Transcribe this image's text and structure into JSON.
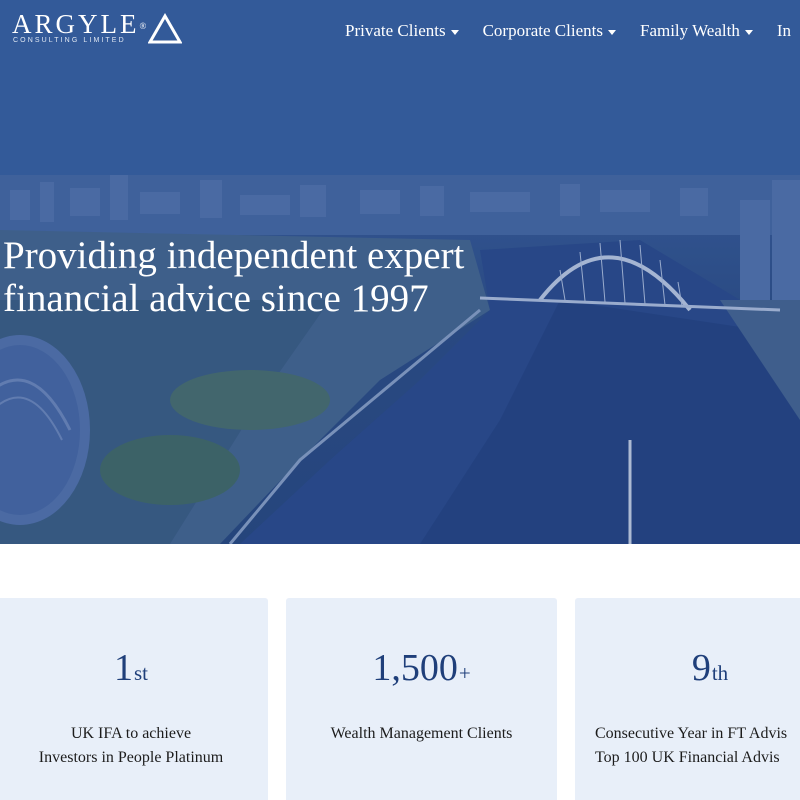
{
  "brand": {
    "name": "ARGYLE",
    "registered": "®",
    "subtitle": "CONSULTING LIMITED",
    "mark_icon": "triangle-icon"
  },
  "nav": {
    "items": [
      {
        "label": "Private Clients",
        "has_dropdown": true
      },
      {
        "label": "Corporate Clients",
        "has_dropdown": true
      },
      {
        "label": "Family Wealth",
        "has_dropdown": true
      },
      {
        "label": "In",
        "has_dropdown": false
      }
    ]
  },
  "hero": {
    "line1": "Providing independent expert",
    "line2": "financial advice since 1997"
  },
  "stats": [
    {
      "value": "1",
      "suffix": "st",
      "line1": "UK IFA to achieve",
      "line2": "Investors in People Platinum"
    },
    {
      "value": "1,500",
      "suffix": "+",
      "line1": "Wealth Management Clients",
      "line2": ""
    },
    {
      "value": "9",
      "suffix": "th",
      "line1": "Consecutive Year in FT Advis",
      "line2": "Top 100 UK Financial Advis"
    }
  ],
  "colors": {
    "hero_blue": "#2d4d82",
    "accent_navy": "#1f3f7a",
    "card_background": "#e8eff9",
    "text_dark": "#1c1c1c"
  }
}
